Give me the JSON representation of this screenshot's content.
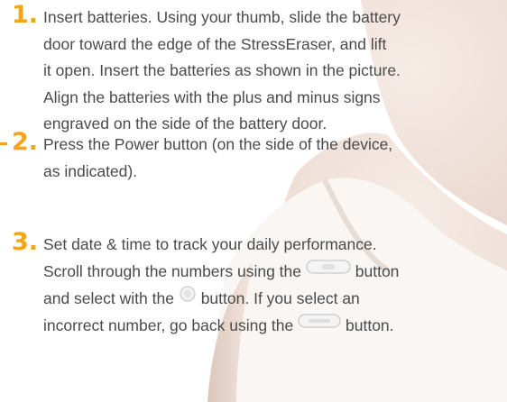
{
  "steps": [
    {
      "number": "1.",
      "lines": [
        "Insert batteries. Using your thumb, slide the battery",
        "door toward the edge of the StressEraser, and lift",
        "it open. Insert the batteries as shown in the picture.",
        "Align the batteries with the plus and minus signs",
        "engraved on the side of the battery door."
      ]
    },
    {
      "number": "2.",
      "lines": [
        "Press the Power button (on the side of the device,",
        "as indicated)."
      ]
    },
    {
      "number": "3.",
      "lines": [
        "Set date & time to track your daily performance.",
        "Scroll through the numbers using the",
        "button",
        "and select with the",
        "button. If you select an",
        "incorrect number, go back using the",
        "button."
      ]
    }
  ],
  "icons": {
    "scroll_button": "scroll-wheel-button-icon",
    "select_button": "round-select-button-icon",
    "back_button": "back-button-icon"
  },
  "colors": {
    "accent": "#f2a51a",
    "text": "#4a4a4a",
    "background_photo": "#f0e4dd"
  }
}
